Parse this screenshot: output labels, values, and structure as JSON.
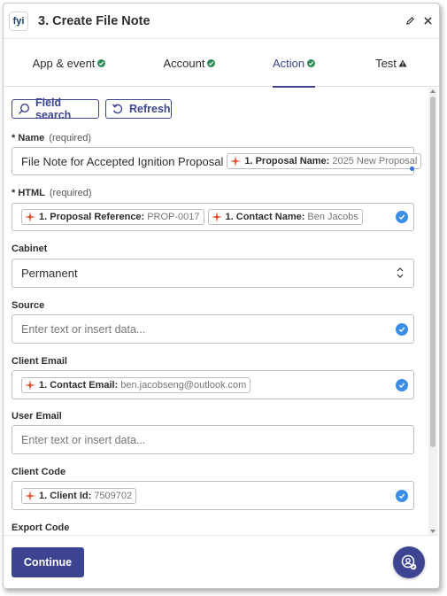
{
  "header": {
    "logo_text": "fyi",
    "title": "3. Create File Note",
    "edit_icon": "pencil-icon",
    "close_icon": "close-icon"
  },
  "tabs": [
    {
      "label": "App & event",
      "status": "complete"
    },
    {
      "label": "Account",
      "status": "complete"
    },
    {
      "label": "Action",
      "status": "complete",
      "active": true
    },
    {
      "label": "Test",
      "status": "warning"
    }
  ],
  "toolbar": {
    "field_search_label": "Field search",
    "refresh_label": "Refresh"
  },
  "fields": {
    "name": {
      "label": "Name",
      "required_note": "(required)",
      "value": "File Note for Accepted Ignition Proposal",
      "pill_key": "1. Proposal Name:",
      "pill_value": "2025 New Proposal"
    },
    "html": {
      "label": "HTML",
      "required_note": "(required)",
      "pill1_key": "1. Proposal Reference:",
      "pill1_value": "PROP-0017",
      "pill2_key": "1. Contact Name:",
      "pill2_value": "Ben Jacobs"
    },
    "cabinet": {
      "label": "Cabinet",
      "value": "Permanent"
    },
    "source": {
      "label": "Source",
      "placeholder": "Enter text or insert data..."
    },
    "client_email": {
      "label": "Client Email",
      "pill_key": "1. Contact Email:",
      "pill_value": "ben.jacobseng@outlook.com"
    },
    "user_email": {
      "label": "User Email",
      "placeholder": "Enter text or insert data..."
    },
    "client_code": {
      "label": "Client Code",
      "pill_key": "1. Client Id:",
      "pill_value": "7509702"
    },
    "export_code": {
      "label": "Export Code"
    }
  },
  "footer": {
    "continue_label": "Continue",
    "fab_icon": "support-chat-icon"
  },
  "colors": {
    "brand": "#3d4592",
    "success": "#2e8a57",
    "valid": "#3b8ee8",
    "spark": "#e8492b"
  }
}
